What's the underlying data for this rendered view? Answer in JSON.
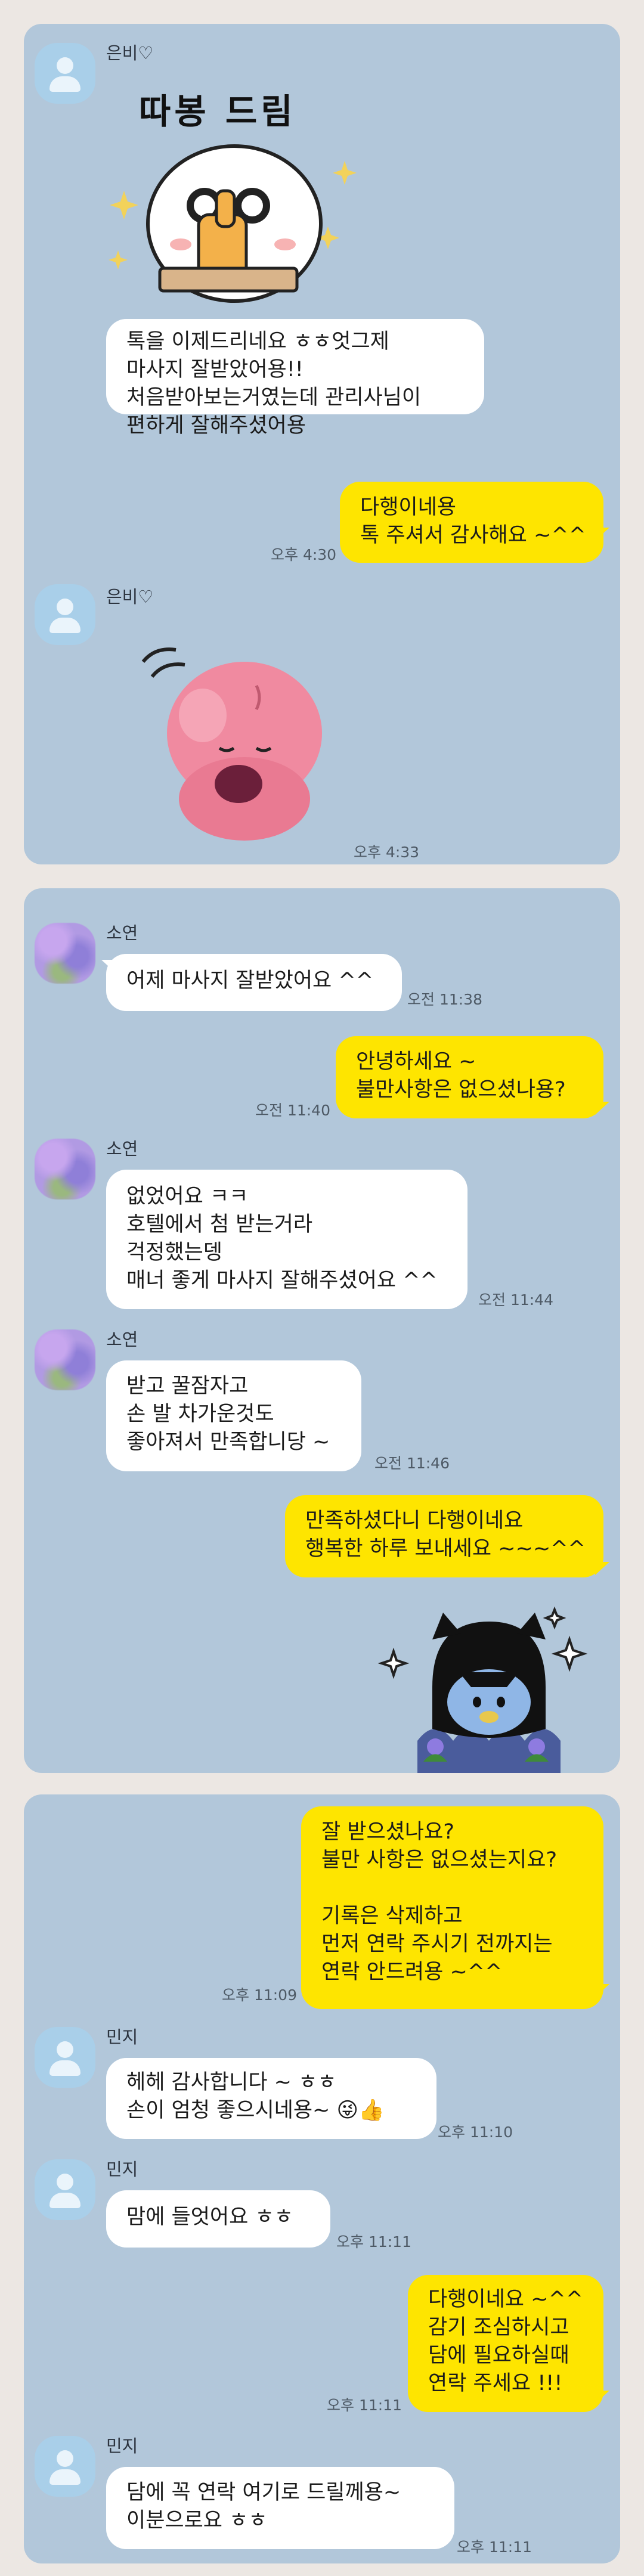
{
  "panel1": {
    "sender1": "은비♡",
    "sticker_caption": "따봉 드림",
    "msg1": "톡을 이제드리네요 ㅎㅎ엇그제\n마사지 잘받았어용!!\n처음받아보는거였는데 관리사님이\n편하게 잘해주셨어용",
    "reply1": "다행이네용\n톡 주셔서 감사해요 ~^^",
    "reply1_time": "오후 4:30",
    "sender2": "은비♡",
    "sticker2_time": "오후 4:33"
  },
  "panel2": {
    "sender": "소연",
    "msg1": "어제 마사지 잘받았어요 ^^",
    "msg1_time": "오전 11:38",
    "reply1": "안녕하세요 ~\n불만사항은 없으셨나용?",
    "reply1_time": "오전 11:40",
    "msg2": "없었어요 ㅋㅋ\n호텔에서 첨 받는거라\n걱정했는뎅\n매너 좋게 마사지 잘해주셨어요 ^^",
    "msg2_time": "오전 11:44",
    "msg3": "받고 꿀잠자고\n손 발 차가운것도\n좋아져서 만족합니당 ~",
    "msg3_time": "오전 11:46",
    "reply2": "만족하셨다니 다행이네요\n행복한 하루 보내세요 ~~~^^"
  },
  "panel3": {
    "reply1": "잘 받으셨나요?\n불만 사항은 없으셨는지요?\n\n기록은 삭제하고\n먼저 연락 주시기 전까지는\n연락 안드려용 ~^^",
    "reply1_time": "오후 11:09",
    "sender": "민지",
    "msg1": "헤헤 감사합니다 ~ ㅎㅎ\n손이 엄청 좋으시네용~ 😜👍",
    "msg1_time": "오후 11:10",
    "msg2": "맘에 들엇어요 ㅎㅎ",
    "msg2_time": "오후 11:11",
    "reply2": "다행이네요 ~^^\n감기 조심하시고\n담에 필요하실때\n연락 주세요 !!!",
    "reply2_time": "오후 11:11",
    "msg3": "담에 꼭 연락 여기로 드릴께용~\n이분으로요 ㅎㅎ",
    "msg3_time": "오후 11:11"
  }
}
